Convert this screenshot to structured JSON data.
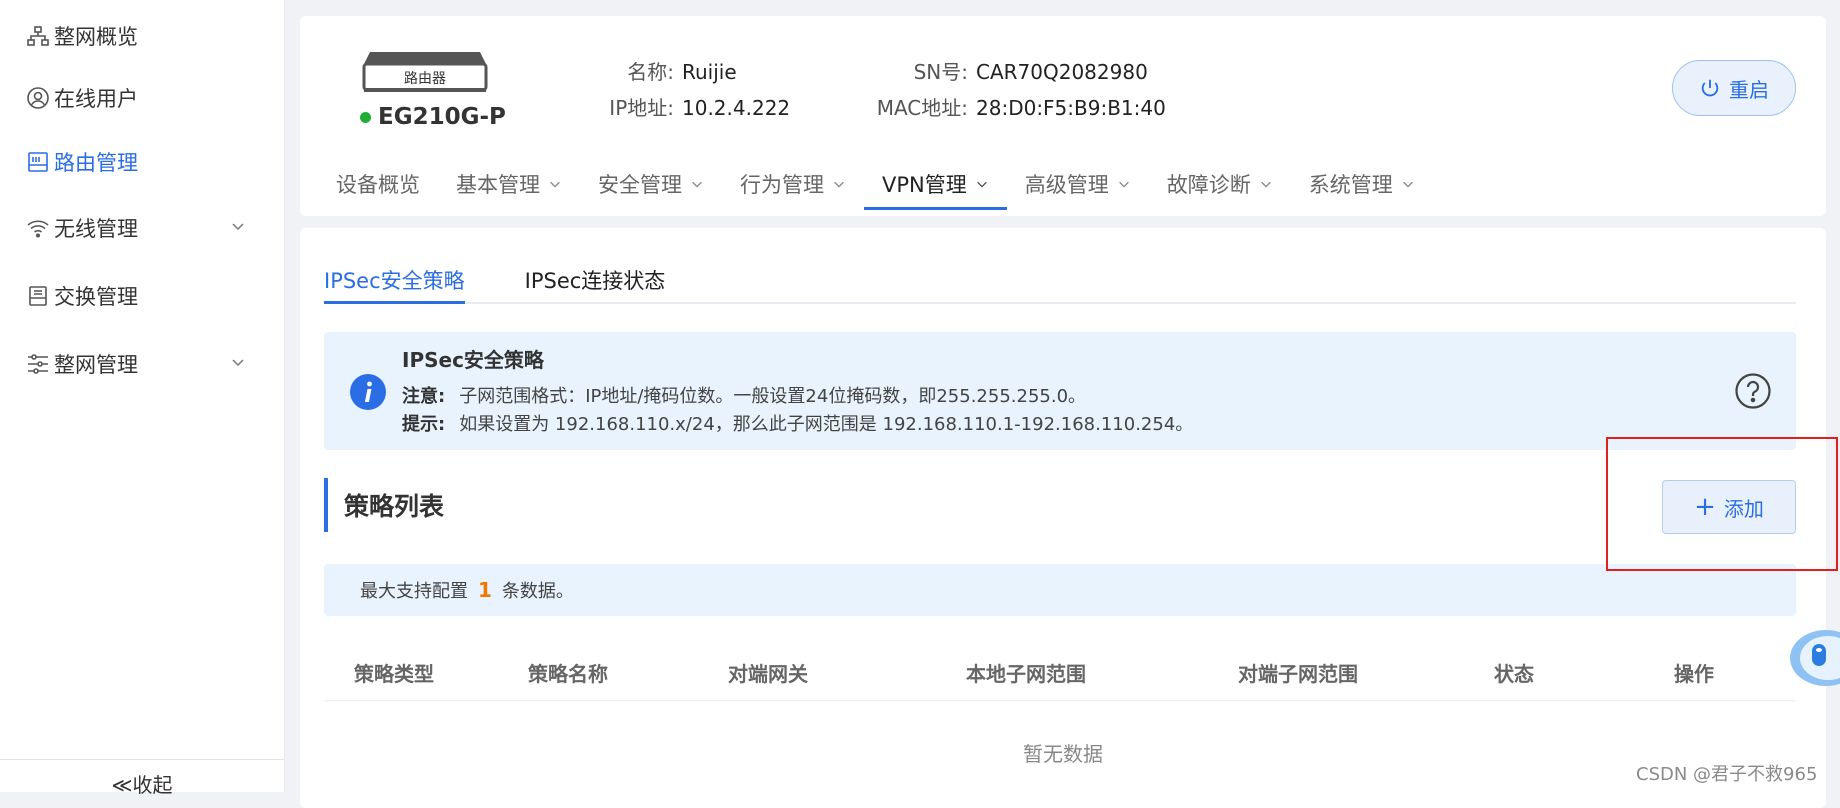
{
  "sidebar": {
    "items": [
      {
        "label": "整网概览",
        "icon": "topology-icon"
      },
      {
        "label": "在线用户",
        "icon": "user-icon"
      },
      {
        "label": "路由管理",
        "icon": "router-icon",
        "active": true
      },
      {
        "label": "无线管理",
        "icon": "wifi-icon",
        "expandable": true
      },
      {
        "label": "交换管理",
        "icon": "switch-icon"
      },
      {
        "label": "整网管理",
        "icon": "network-settings-icon",
        "expandable": true
      }
    ],
    "collapse_label": "≪收起"
  },
  "device": {
    "badge": "路由器",
    "model": "EG210G-P",
    "status_color": "#1fae37",
    "name_label": "名称:",
    "name_value": "Ruijie",
    "ip_label": "IP地址:",
    "ip_value": "10.2.4.222",
    "sn_label": "SN号:",
    "sn_value": "CAR70Q2082980",
    "mac_label": "MAC地址:",
    "mac_value": "28:D0:F5:B9:B1:40",
    "restart_label": "重启"
  },
  "nav_tabs": [
    {
      "label": "设备概览",
      "dropdown": false
    },
    {
      "label": "基本管理",
      "dropdown": true
    },
    {
      "label": "安全管理",
      "dropdown": true
    },
    {
      "label": "行为管理",
      "dropdown": true
    },
    {
      "label": "VPN管理",
      "dropdown": true,
      "active": true
    },
    {
      "label": "高级管理",
      "dropdown": true
    },
    {
      "label": "故障诊断",
      "dropdown": true
    },
    {
      "label": "系统管理",
      "dropdown": true
    }
  ],
  "sub_tabs": [
    "IPSec安全策略",
    "IPSec连接状态"
  ],
  "notice": {
    "title": "IPSec安全策略",
    "note_label": "注意:",
    "note_text": "子网范围格式：IP地址/掩码位数。一般设置24位掩码数，即255.255.255.0。",
    "tip_label": "提示:",
    "tip_text": "如果设置为 192.168.110.x/24，那么此子网范围是 192.168.110.1-192.168.110.254。"
  },
  "section": {
    "title": "策略列表",
    "add_label": "添加",
    "limit_prefix": "最大支持配置",
    "limit_num": "1",
    "limit_suffix": "条数据。"
  },
  "table": {
    "columns": [
      "策略类型",
      "策略名称",
      "对端网关",
      "本地子网范围",
      "对端子网范围",
      "状态",
      "操作"
    ],
    "empty_text": "暂无数据"
  },
  "watermark": "CSDN @君子不救965",
  "colors": {
    "accent": "#2b6de5",
    "highlight": "#e02020",
    "count": "#f07800"
  }
}
